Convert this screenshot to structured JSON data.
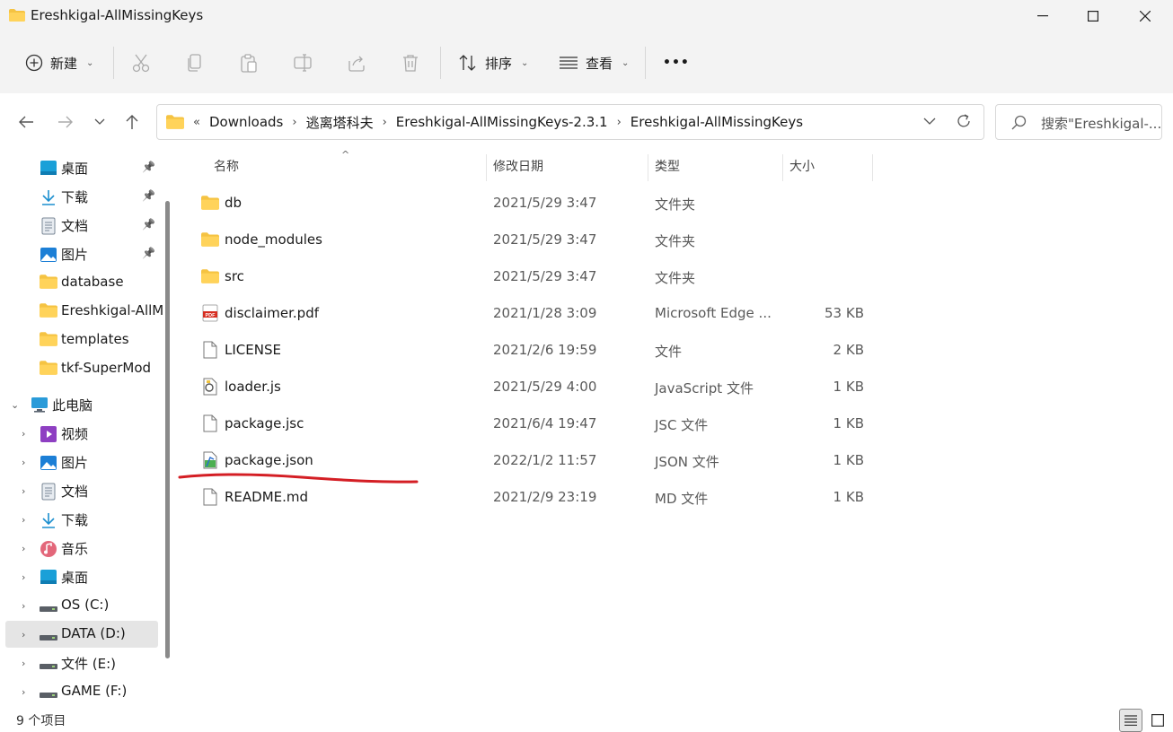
{
  "window": {
    "title": "Ereshkigal-AllMissingKeys"
  },
  "toolbar": {
    "new_label": "新建",
    "sort_label": "排序",
    "view_label": "查看",
    "more_label": "•••"
  },
  "address": {
    "overflow": "«",
    "crumbs": [
      "Downloads",
      "逃离塔科夫",
      "Ereshkigal-AllMissingKeys-2.3.1",
      "Ereshkigal-AllMissingKeys"
    ],
    "search_placeholder": "搜索\"Ereshkigal-..."
  },
  "sidebar": {
    "quick_access": [
      {
        "label": "桌面",
        "icon": "desktop-icon",
        "pinned": true
      },
      {
        "label": "下载",
        "icon": "download-icon",
        "pinned": true
      },
      {
        "label": "文档",
        "icon": "document-icon",
        "pinned": true
      },
      {
        "label": "图片",
        "icon": "picture-icon",
        "pinned": true
      },
      {
        "label": "database",
        "icon": "folder-icon",
        "pinned": false
      },
      {
        "label": "Ereshkigal-AllM",
        "icon": "folder-icon",
        "pinned": false
      },
      {
        "label": "templates",
        "icon": "folder-icon",
        "pinned": false
      },
      {
        "label": "tkf-SuperMod",
        "icon": "folder-icon",
        "pinned": false
      }
    ],
    "this_pc": "此电脑",
    "pc_items": [
      {
        "label": "视频",
        "icon": "video-icon"
      },
      {
        "label": "图片",
        "icon": "picture-icon"
      },
      {
        "label": "文档",
        "icon": "document-icon"
      },
      {
        "label": "下载",
        "icon": "download-icon"
      },
      {
        "label": "音乐",
        "icon": "music-icon"
      },
      {
        "label": "桌面",
        "icon": "desktop-icon"
      },
      {
        "label": "OS (C:)",
        "icon": "drive-icon"
      },
      {
        "label": "DATA (D:)",
        "icon": "drive-icon",
        "selected": true
      },
      {
        "label": "文件 (E:)",
        "icon": "drive-icon"
      },
      {
        "label": "GAME (F:)",
        "icon": "drive-icon"
      }
    ]
  },
  "columns": {
    "name": "名称",
    "date": "修改日期",
    "type": "类型",
    "size": "大小"
  },
  "files": [
    {
      "name": "db",
      "date": "2021/5/29 3:47",
      "type": "文件夹",
      "size": "",
      "icon": "folder-icon"
    },
    {
      "name": "node_modules",
      "date": "2021/5/29 3:47",
      "type": "文件夹",
      "size": "",
      "icon": "folder-icon"
    },
    {
      "name": "src",
      "date": "2021/5/29 3:47",
      "type": "文件夹",
      "size": "",
      "icon": "folder-icon"
    },
    {
      "name": "disclaimer.pdf",
      "date": "2021/1/28 3:09",
      "type": "Microsoft Edge ...",
      "size": "53 KB",
      "icon": "pdf-icon"
    },
    {
      "name": "LICENSE",
      "date": "2021/2/6 19:59",
      "type": "文件",
      "size": "2 KB",
      "icon": "file-icon"
    },
    {
      "name": "loader.js",
      "date": "2021/5/29 4:00",
      "type": "JavaScript 文件",
      "size": "1 KB",
      "icon": "script-icon"
    },
    {
      "name": "package.jsc",
      "date": "2021/6/4 19:47",
      "type": "JSC 文件",
      "size": "1 KB",
      "icon": "file-icon"
    },
    {
      "name": "package.json",
      "date": "2022/1/2 11:57",
      "type": "JSON 文件",
      "size": "1 KB",
      "icon": "json-icon"
    },
    {
      "name": "README.md",
      "date": "2021/2/9 23:19",
      "type": "MD 文件",
      "size": "1 KB",
      "icon": "file-icon"
    }
  ],
  "status": {
    "item_count": "9 个项目"
  }
}
